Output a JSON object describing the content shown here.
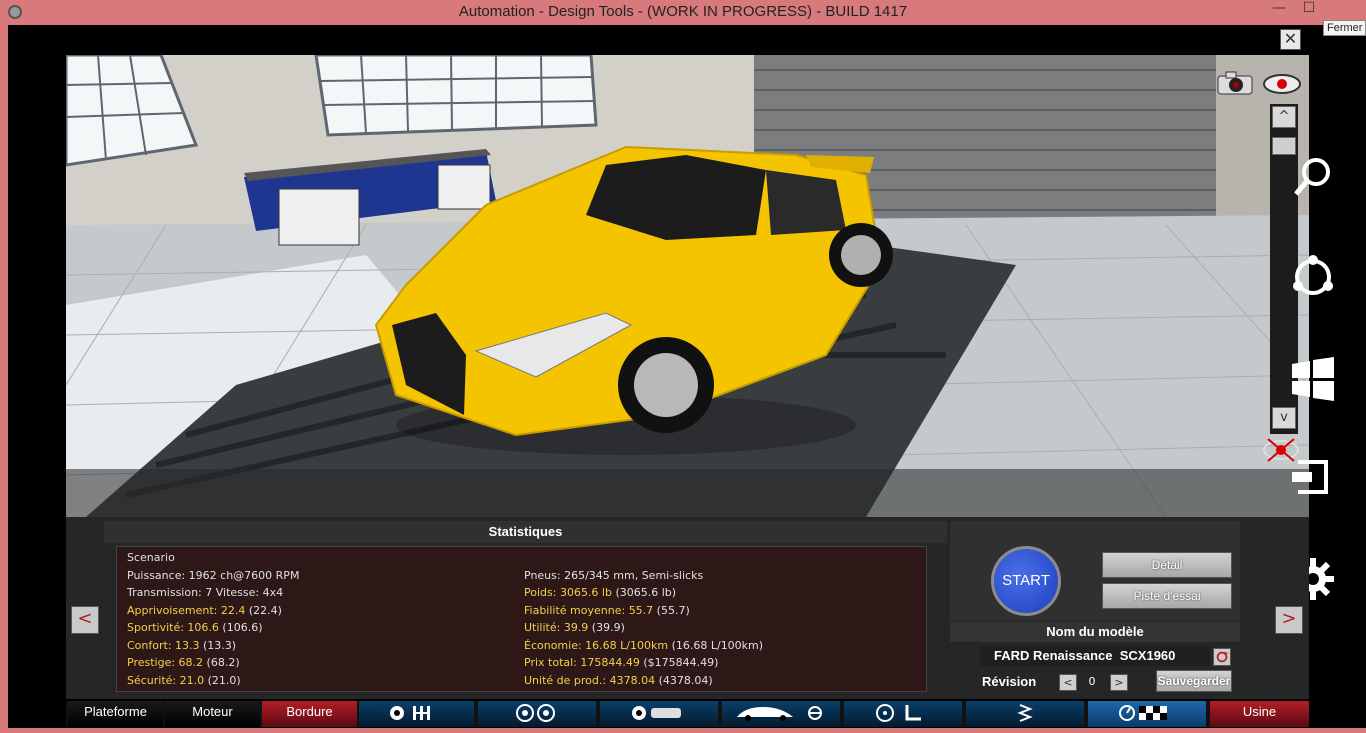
{
  "window": {
    "title": "Automation - Design Tools - (WORK IN PROGRESS) - BUILD 1417",
    "min_glyph": "—",
    "max_glyph": "☐",
    "tooltip": "Fermer"
  },
  "viewer": {
    "close_glyph": "✕",
    "scroll_up": "^",
    "scroll_down": "v"
  },
  "stats": {
    "header": "Statistiques",
    "left": [
      {
        "label": "Scenario",
        "value": "",
        "extra": ""
      },
      {
        "label": "Puissance: 1962 ch@7600 RPM",
        "value": "",
        "extra": ""
      },
      {
        "label": "Transmission: 7 Vitesse: 4x4",
        "value": "",
        "extra": ""
      },
      {
        "label": "Apprivoisement: 22.4",
        "value": "",
        "extra": " (22.4)"
      },
      {
        "label": "Sportivité: 106.6",
        "value": "",
        "extra": " (106.6)"
      },
      {
        "label": "Confort: 13.3",
        "value": "",
        "extra": " (13.3)"
      },
      {
        "label": "Prestige: 68.2",
        "value": "",
        "extra": " (68.2)"
      },
      {
        "label": "Sécurité: 21.0",
        "value": "",
        "extra": " (21.0)"
      }
    ],
    "right": [
      {
        "label": "",
        "extra": ""
      },
      {
        "label": "Pneus: 265/345 mm, Semi-slicks",
        "extra": ""
      },
      {
        "label": "Poids: 3065.6 lb",
        "extra": " (3065.6 lb)"
      },
      {
        "label": "Fiabilité moyenne: 55.7",
        "extra": " (55.7)"
      },
      {
        "label": "Utilité: 39.9",
        "extra": " (39.9)"
      },
      {
        "label": "Économie: 16.68 L/100km",
        "extra": " (16.68 L/100km)"
      },
      {
        "label": "Prix total: 175844.49",
        "extra": " ($175844.49)"
      },
      {
        "label": "Unité de prod.: 4378.04",
        "extra": " (4378.04)"
      }
    ]
  },
  "nav": {
    "prev": "<",
    "next": ">"
  },
  "actions": {
    "start": "START",
    "detail": "Détail",
    "test_track": "Piste d'essai",
    "model_header": "Nom du modèle",
    "model_name": "FARD Renaissance",
    "model_variant": "SCX1960",
    "revision_label": "Révision",
    "revision_value": "0",
    "rev_minus": "<",
    "rev_plus": ">",
    "save": "Sauvegarder"
  },
  "tabs": {
    "platform": "Plateforme",
    "engine": "Moteur",
    "trim": "Bordure",
    "factory": "Usine"
  },
  "colors": {
    "titlebar": "#d87a7c",
    "highlight_stat": "#f2d14a",
    "active_tab": "#b41e28",
    "car_body": "#f5c400",
    "start_button": "#1d3fbf"
  }
}
